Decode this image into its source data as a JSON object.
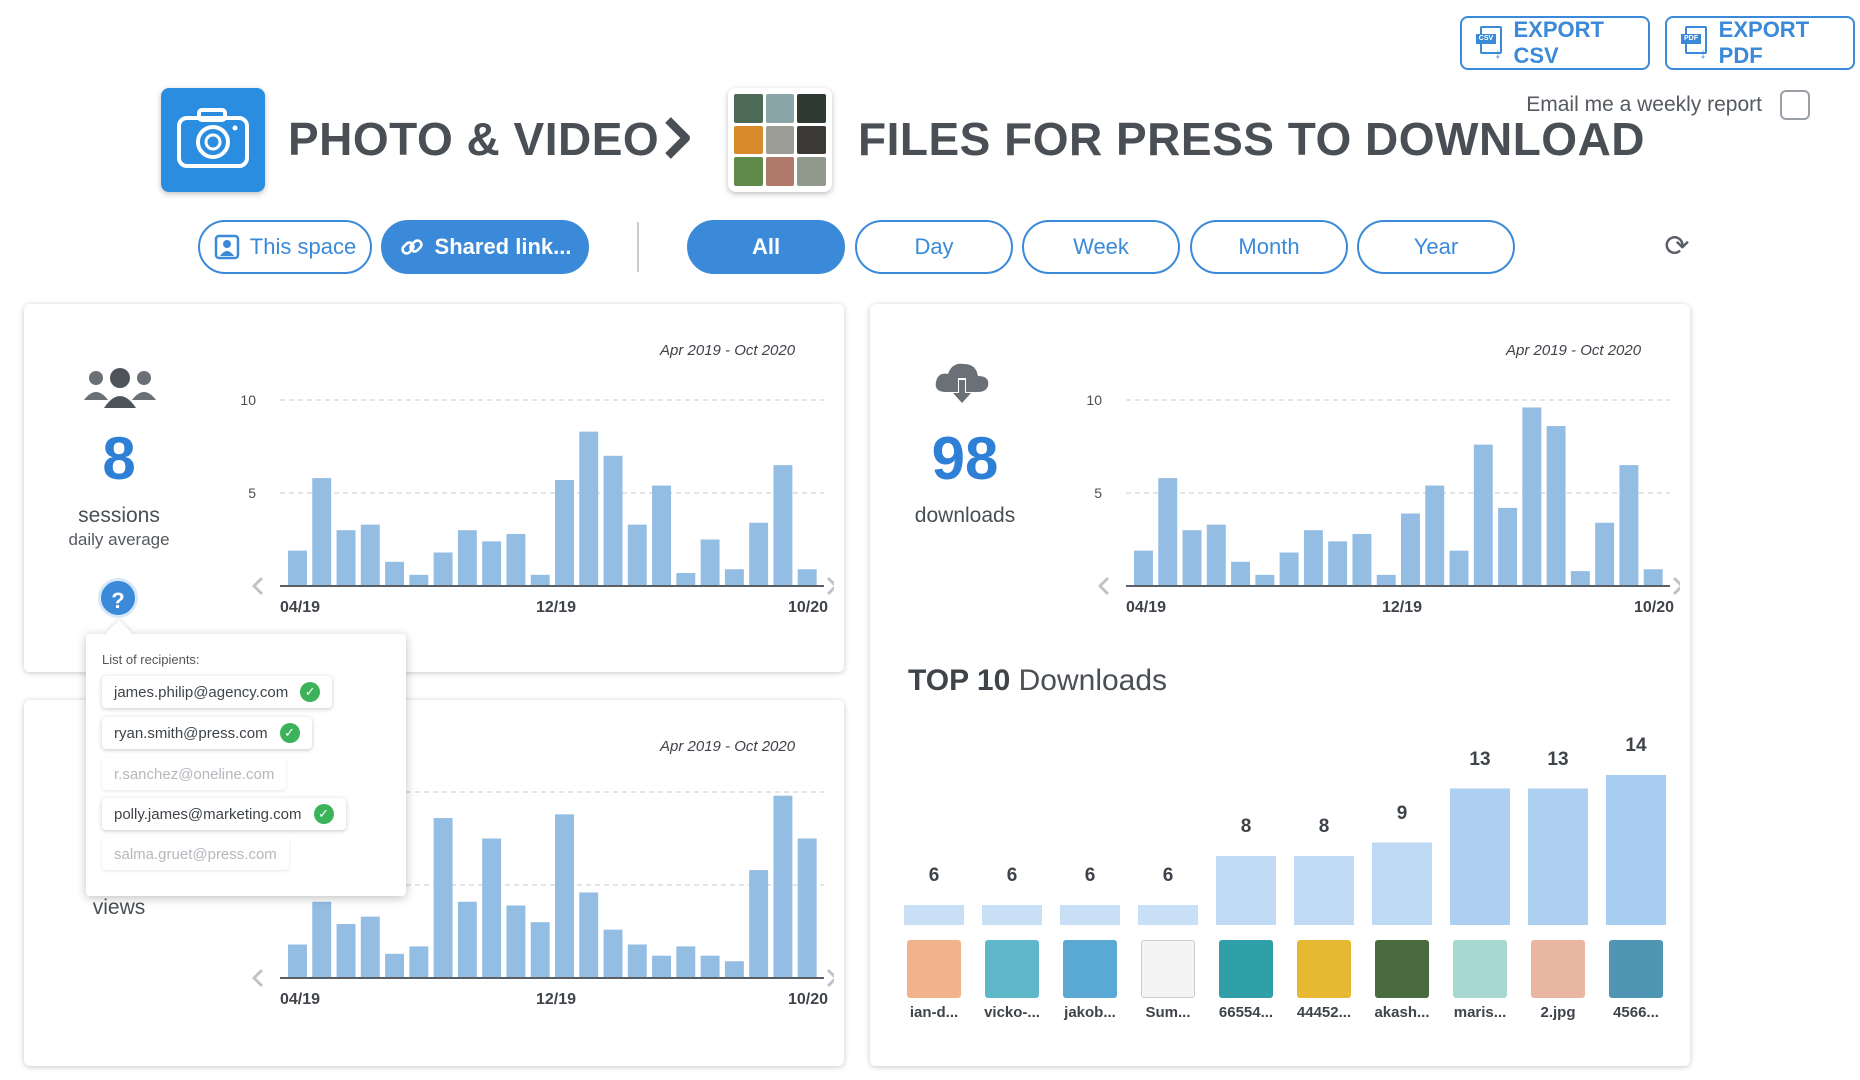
{
  "header": {
    "export_csv": "EXPORT CSV",
    "export_pdf": "EXPORT PDF",
    "csv_tag": "CSV",
    "pdf_tag": "PDF",
    "weekly_report": "Email me a weekly report",
    "space_name": "PHOTO & VIDEO",
    "folder_name": "FILES FOR PRESS TO DOWNLOAD"
  },
  "filters": {
    "this_space": "This space",
    "shared_link": "Shared link...",
    "periods": [
      "All",
      "Day",
      "Week",
      "Month",
      "Year"
    ],
    "active_period": "All"
  },
  "sessions_card": {
    "value": "8",
    "label": "sessions",
    "sublabel": "daily average",
    "range": "Apr 2019 - Oct 2020"
  },
  "views_card": {
    "label": "views",
    "range": "Apr 2019 - Oct 2020"
  },
  "downloads_card": {
    "value": "98",
    "label": "downloads",
    "range": "Apr 2019 - Oct 2020"
  },
  "recipients": {
    "title": "List of recipients:",
    "items": [
      {
        "email": "james.philip@agency.com",
        "active": true
      },
      {
        "email": "ryan.smith@press.com",
        "active": true
      },
      {
        "email": "r.sanchez@oneline.com",
        "active": false
      },
      {
        "email": "polly.james@marketing.com",
        "active": true
      },
      {
        "email": "salma.gruet@press.com",
        "active": false
      }
    ]
  },
  "top_downloads": {
    "title_bold": "TOP 10",
    "title_rest": " Downloads"
  },
  "colors": {
    "accent": "#3b8ad9",
    "bar": "#94bde3",
    "top_bar": "#a9cdf0",
    "check": "#3cb35a"
  },
  "chart_data": [
    {
      "type": "bar",
      "name": "sessions",
      "x_ticks": [
        "04/19",
        "12/19",
        "10/20"
      ],
      "y_ticks": [
        5,
        10
      ],
      "ylim": [
        0,
        10
      ],
      "grid": true,
      "values": [
        1.9,
        5.8,
        3,
        3.3,
        1.3,
        0.6,
        1.8,
        3,
        2.4,
        2.8,
        0.6,
        5.7,
        8.3,
        7,
        3.3,
        5.4,
        0.7,
        2.5,
        0.9,
        3.4,
        6.5,
        0.9
      ]
    },
    {
      "type": "bar",
      "name": "views",
      "x_ticks": [
        "04/19",
        "12/19",
        "10/20"
      ],
      "y_ticks": [],
      "ylim": [
        0,
        10
      ],
      "grid": true,
      "values": [
        1.8,
        4.1,
        2.9,
        3.3,
        1.3,
        1.7,
        8.6,
        4.1,
        7.5,
        3.9,
        3,
        8.8,
        4.6,
        2.6,
        1.8,
        1.2,
        1.7,
        1.2,
        0.9,
        5.8,
        9.8,
        7.5
      ]
    },
    {
      "type": "bar",
      "name": "downloads",
      "x_ticks": [
        "04/19",
        "12/19",
        "10/20"
      ],
      "y_ticks": [
        5,
        10
      ],
      "ylim": [
        0,
        10
      ],
      "grid": true,
      "values": [
        1.9,
        5.8,
        3,
        3.3,
        1.3,
        0.6,
        1.8,
        3,
        2.4,
        2.8,
        0.6,
        3.9,
        5.4,
        1.9,
        7.6,
        4.2,
        9.6,
        8.6,
        0.8,
        3.4,
        6.5,
        0.9
      ]
    },
    {
      "type": "bar",
      "name": "top10",
      "categories": [
        "ian-d...",
        "vicko-...",
        "jakob...",
        "Sum...",
        "66554...",
        "44452...",
        "akash...",
        "maris...",
        "2.jpg",
        "4566..."
      ],
      "values": [
        6,
        6,
        6,
        6,
        8,
        8,
        9,
        13,
        13,
        14
      ],
      "thumbs": [
        "#f2b38c",
        "#5fb8c9",
        "#5aa8d4",
        "#f4f4f4",
        "#2f9fa8",
        "#e7b933",
        "#4a6b3f",
        "#a7d8d2",
        "#e9b7a1",
        "#4f96b5"
      ]
    }
  ]
}
